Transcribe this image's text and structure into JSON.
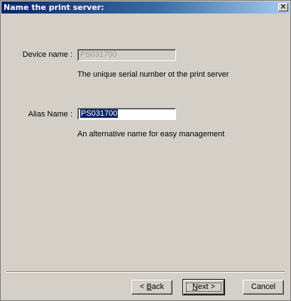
{
  "window": {
    "title": "Name the print server:",
    "close_glyph": "✕"
  },
  "form": {
    "device_name": {
      "label": "Device name :",
      "value": "PS031700",
      "hint": "The unique serial number ot the print server"
    },
    "alias_name": {
      "label": "Alias Name :",
      "value": "PS031700",
      "hint": "An alternative name for easy management"
    }
  },
  "buttons": {
    "back": {
      "prefix": "< ",
      "mnemonic": "B",
      "rest": "ack"
    },
    "next": {
      "mnemonic": "N",
      "rest": "ext >"
    },
    "cancel": "Cancel"
  }
}
